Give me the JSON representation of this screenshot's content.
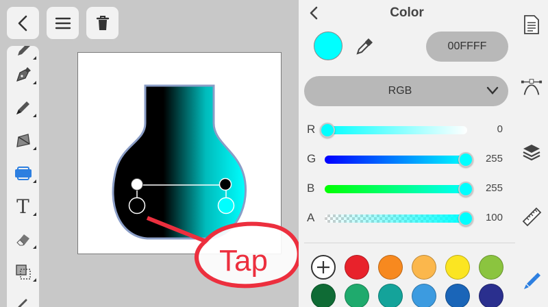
{
  "top_buttons": {
    "back": "chevron-left-icon",
    "menu": "hamburger-icon",
    "delete": "trash-icon"
  },
  "tools": [
    "pencil-icon",
    "pen-tool-icon",
    "brush-icon",
    "shape-tool-icon",
    "fill-tool-icon",
    "text-tool-icon",
    "eraser-icon",
    "selection-icon"
  ],
  "tool_text_glyph": "T",
  "annotation": {
    "text": "Tap",
    "color": "#ec2f3e"
  },
  "panel": {
    "title": "Color",
    "current_color": "#00FFFF",
    "hex_value": "00FFFF",
    "mode": "RGB",
    "sliders": [
      {
        "label": "R",
        "value": "0",
        "fraction": 0.0
      },
      {
        "label": "G",
        "value": "255",
        "fraction": 1.0
      },
      {
        "label": "B",
        "value": "255",
        "fraction": 1.0
      },
      {
        "label": "A",
        "value": "100",
        "fraction": 1.0
      }
    ],
    "palette_row1": [
      "#e8222b",
      "#f7891f",
      "#fbb74c",
      "#fbe522",
      "#8bc43f"
    ],
    "palette_row2": [
      "#0f6b35",
      "#1faa6d",
      "#14a39a",
      "#3c9be0",
      "#1a65b8",
      "#2a2f8e"
    ]
  },
  "side_bar_icons": [
    "document-icon",
    "curve-tool-icon",
    "layers-icon",
    "ruler-icon",
    "color-brush-icon"
  ],
  "colors": {
    "accent": "#2d7fe0",
    "panel_bg": "#f2f2f2",
    "canvas_bg": "#c8c8c8"
  }
}
